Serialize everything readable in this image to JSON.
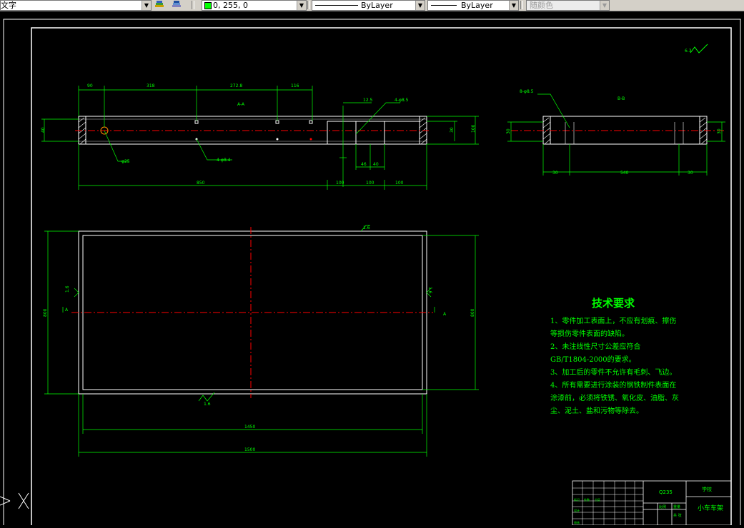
{
  "toolbar": {
    "text_style": "文字",
    "color_value": "0, 255, 0",
    "linetype": "ByLayer",
    "lineweight": "ByLayer",
    "plot_style": "随颜色"
  },
  "colors": {
    "drawing": "#ffffff",
    "dimension": "#00ff00",
    "centerline": "#ff0000",
    "background": "#000000"
  },
  "icons": [
    "layer-icon",
    "layer-states-icon",
    "ucs-icon"
  ],
  "drawing": {
    "roughness_top": "6.3",
    "dims_top": [
      "90",
      "318",
      "272.8",
      "116"
    ],
    "dim_overall": "850",
    "dim_height_left": "40",
    "dim_height_right": "30",
    "dim_total_height": "100",
    "hole_diameter": "φ25",
    "hole_pattern": "4-φ8.4",
    "section_label": "A-A",
    "section_dims": [
      "12.5",
      "46",
      "40"
    ],
    "section_bottom": [
      "100",
      "100",
      "100"
    ],
    "section_hole": "4-φ8.5",
    "side_top_label": "8-φ8.5",
    "side_view_label": "B-B",
    "side_dims": [
      "30",
      "540",
      "30"
    ],
    "side_height": "30",
    "plan_roughness": "1.6",
    "plan_dims": [
      "1450",
      "1500"
    ],
    "plan_height": "800",
    "plan_height_inner": "800",
    "plan_side_marks": [
      "B",
      "A"
    ],
    "plan_side_roughness": [
      "1.6",
      "1.6"
    ]
  },
  "notes": {
    "title": "技术要求",
    "lines": [
      "1、零件加工表面上，不应有划痕、擦伤等损伤零件表面的缺陷。",
      "2、未注线性尺寸公差应符合GB/T1804-2000的要求。",
      "3、加工后的零件不允许有毛刺、飞边。",
      "4、所有需要进行涂装的钢铁制件表面在涂漆前，必须将铁锈、氧化皮、油脂、灰尘、泥土、盐和污物等除去。"
    ]
  },
  "title_block": {
    "part_name": "小车车架",
    "material": "Q235",
    "company": "学校",
    "scale_label": "比例",
    "weight_label": "重量",
    "sheet_label": "共 张"
  }
}
